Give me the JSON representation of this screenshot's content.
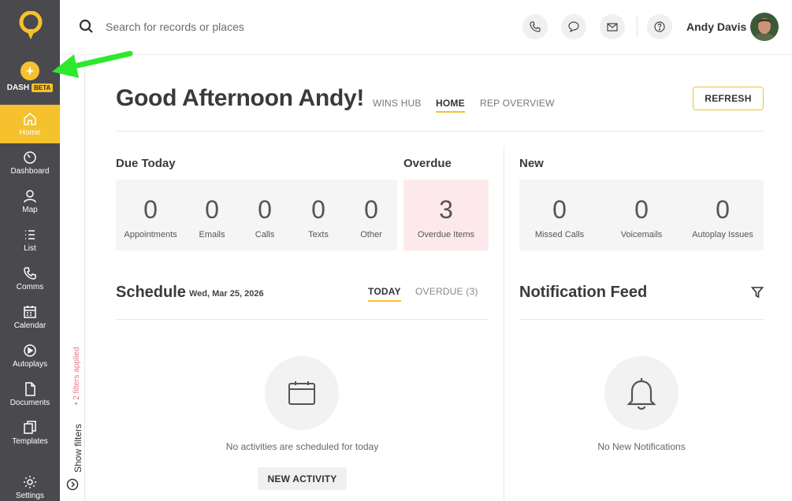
{
  "sidebar": {
    "dash_label": "DASH",
    "beta_label": "BETA",
    "items": [
      {
        "label": "Home",
        "icon": "home-icon"
      },
      {
        "label": "Dashboard",
        "icon": "gauge-icon"
      },
      {
        "label": "Map",
        "icon": "map-pin-icon"
      },
      {
        "label": "List",
        "icon": "list-icon"
      },
      {
        "label": "Comms",
        "icon": "phone-icon"
      },
      {
        "label": "Calendar",
        "icon": "calendar-icon"
      },
      {
        "label": "Autoplays",
        "icon": "play-icon"
      },
      {
        "label": "Documents",
        "icon": "document-icon"
      },
      {
        "label": "Templates",
        "icon": "templates-icon"
      },
      {
        "label": "Settings",
        "icon": "gear-icon"
      }
    ]
  },
  "filters": {
    "show_label": "Show filters",
    "applied_label": "• 2 filters applied"
  },
  "topbar": {
    "search_placeholder": "Search for records or places",
    "user_name": "Andy Davis"
  },
  "header": {
    "greeting": "Good Afternoon Andy!",
    "tabs": [
      "WINS HUB",
      "HOME",
      "REP OVERVIEW"
    ],
    "refresh_label": "REFRESH"
  },
  "due_today": {
    "title": "Due Today",
    "stats": [
      {
        "value": "0",
        "label": "Appointments"
      },
      {
        "value": "0",
        "label": "Emails"
      },
      {
        "value": "0",
        "label": "Calls"
      },
      {
        "value": "0",
        "label": "Texts"
      },
      {
        "value": "0",
        "label": "Other"
      }
    ]
  },
  "overdue": {
    "title": "Overdue",
    "value": "3",
    "label": "Overdue Items"
  },
  "new": {
    "title": "New",
    "stats": [
      {
        "value": "0",
        "label": "Missed Calls"
      },
      {
        "value": "0",
        "label": "Voicemails"
      },
      {
        "value": "0",
        "label": "Autoplay Issues"
      }
    ]
  },
  "schedule": {
    "title": "Schedule",
    "date": "Wed, Mar 25, 2026",
    "tab_today": "TODAY",
    "tab_overdue": "OVERDUE (3)",
    "empty_text": "No activities are scheduled for today",
    "new_activity_label": "NEW ACTIVITY"
  },
  "notifications": {
    "title": "Notification Feed",
    "empty_text": "No New Notifications"
  },
  "colors": {
    "accent": "#f5c12d",
    "sidebar": "#4a4a4e",
    "overdue_bg": "#fde9ec",
    "arrow": "#2ee82e"
  }
}
